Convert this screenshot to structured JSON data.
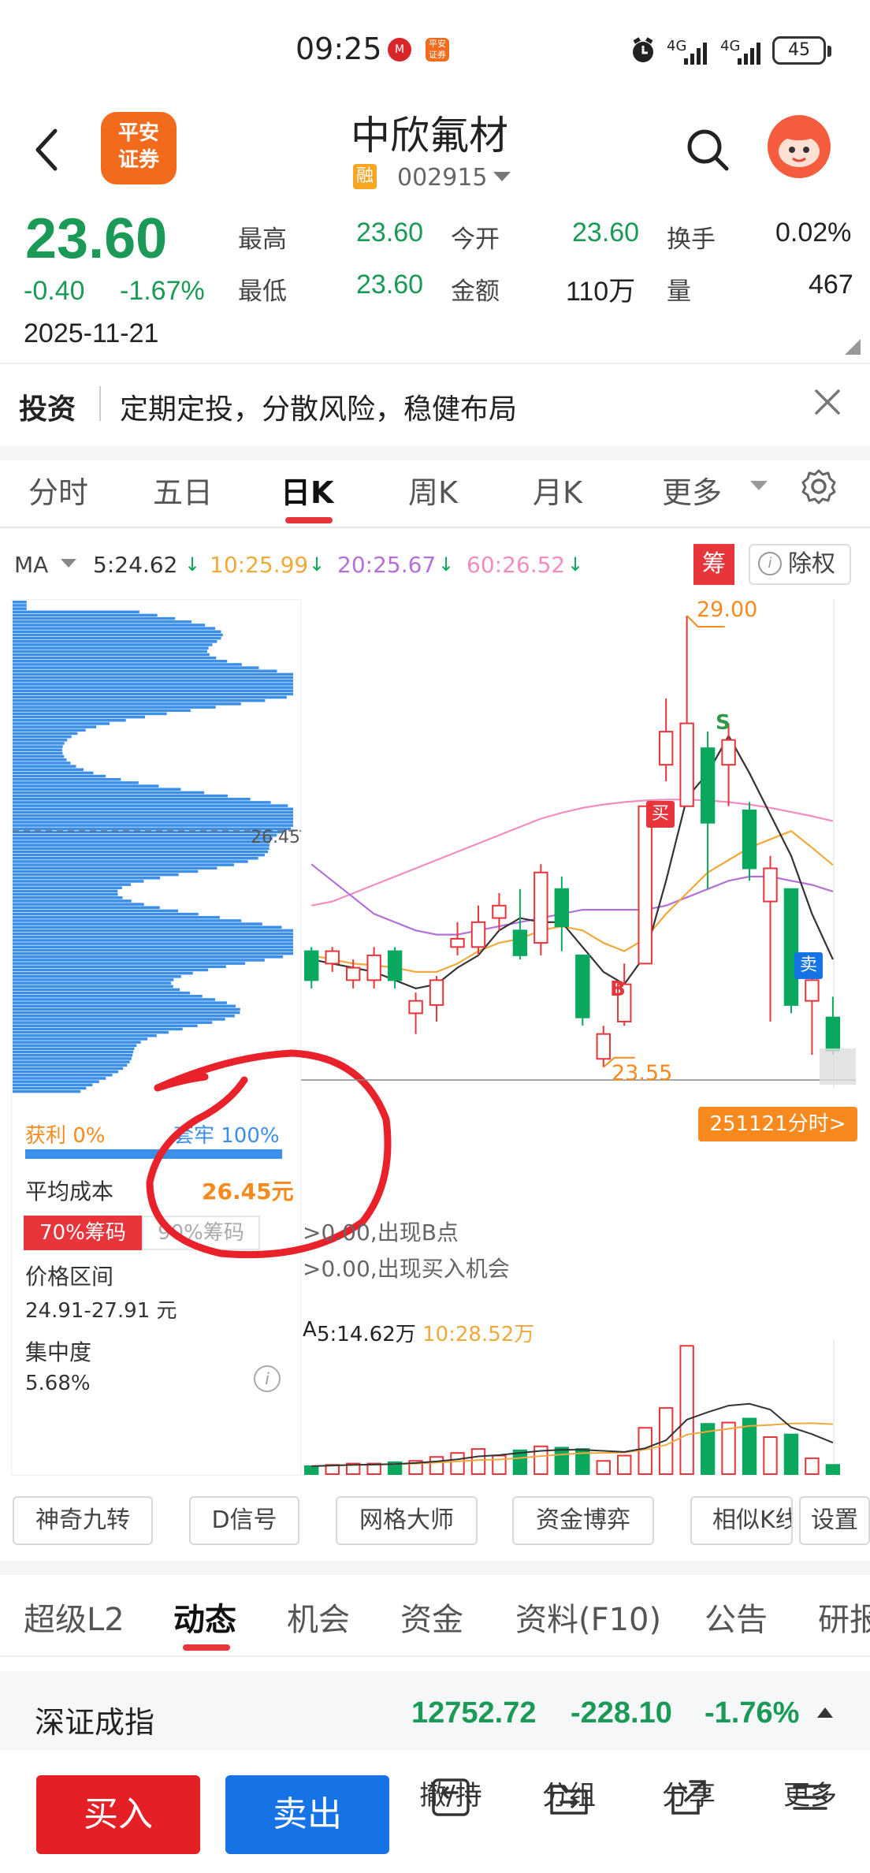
{
  "status_bar": {
    "time": "09:25",
    "battery": "45",
    "network_1": "4G",
    "network_2": "4G",
    "icons": [
      "china-merchants-icon",
      "pingan-app-icon",
      "alarm-icon",
      "signal-icon",
      "signal-icon"
    ]
  },
  "header": {
    "logo_line1": "平安",
    "logo_line2": "证券",
    "stock_name": "中欣氟材",
    "badge": "融",
    "stock_code": "002915"
  },
  "quote": {
    "price": "23.60",
    "change": "-0.40",
    "change_pct": "-1.67%",
    "date": "2025-11-21",
    "high_label": "最高",
    "high": "23.60",
    "low_label": "最低",
    "low": "23.60",
    "open_label": "今开",
    "open": "23.60",
    "amount_label": "金额",
    "amount": "110万",
    "turnover_label": "换手",
    "turnover": "0.02%",
    "volume_label": "量",
    "volume": "467"
  },
  "ad_banner": {
    "tag": "投资",
    "text": "定期定投，分散风险，稳健布局"
  },
  "chart_tabs": [
    "分时",
    "五日",
    "日K",
    "周K",
    "月K",
    "更多"
  ],
  "chart_tabs_active": "日K",
  "ma_row": {
    "label": "MA",
    "ma5": "5:24.62",
    "ma10": "10:25.99",
    "ma20": "20:25.67",
    "ma60": "60:26.52",
    "chip_btn": "筹",
    "exright_btn": "除权"
  },
  "colors": {
    "up": "#e8343b",
    "down": "#0aa85f",
    "ma5": "#333333",
    "ma10": "#f0a93a",
    "ma20": "#b370d8",
    "ma60": "#f28cc0",
    "chip": "#3b8fe8",
    "accent_orange": "#f68a1e",
    "sell_blue": "#1573e6",
    "buy_red": "#e41f26"
  },
  "chip_panel": {
    "price_line": "26.45",
    "profit_label": "获利 0%",
    "trapped_label": "套牢 100%",
    "avg_cost_label": "平均成本",
    "avg_cost": "26.45元",
    "tab_70": "70%筹码",
    "tab_90": "90%筹码",
    "range_label": "价格区间",
    "range_value": "24.91-27.91 元",
    "conc_label": "集中度",
    "conc_value": "5.68%"
  },
  "chart_data": {
    "type": "candlestick",
    "labels": {
      "high": "29.00",
      "low": "23.55",
      "buy_marker": "买",
      "sell_marker": "卖",
      "b_marker": "B",
      "s_marker": "S",
      "time_btn": "251121分时>"
    },
    "price_range": [
      23.3,
      29.2
    ],
    "candles": [
      {
        "o": 24.95,
        "c": 24.6,
        "h": 25.0,
        "l": 24.5
      },
      {
        "o": 24.8,
        "c": 24.95,
        "h": 25.0,
        "l": 24.7
      },
      {
        "o": 24.6,
        "c": 24.75,
        "h": 24.85,
        "l": 24.5
      },
      {
        "o": 24.6,
        "c": 24.9,
        "h": 25.0,
        "l": 24.5
      },
      {
        "o": 24.95,
        "c": 24.6,
        "h": 25.0,
        "l": 24.5
      },
      {
        "o": 24.2,
        "c": 24.35,
        "h": 24.45,
        "l": 23.95
      },
      {
        "o": 24.3,
        "c": 24.6,
        "h": 24.65,
        "l": 24.1
      },
      {
        "o": 25.0,
        "c": 25.1,
        "h": 25.3,
        "l": 24.9
      },
      {
        "o": 25.0,
        "c": 25.3,
        "h": 25.5,
        "l": 24.9
      },
      {
        "o": 25.35,
        "c": 25.5,
        "h": 25.65,
        "l": 25.2
      },
      {
        "o": 25.2,
        "c": 24.9,
        "h": 25.7,
        "l": 24.85
      },
      {
        "o": 25.05,
        "c": 25.9,
        "h": 26.0,
        "l": 24.9
      },
      {
        "o": 25.7,
        "c": 25.25,
        "h": 25.85,
        "l": 24.95
      },
      {
        "o": 24.9,
        "c": 24.15,
        "h": 24.9,
        "l": 24.05
      },
      {
        "o": 23.65,
        "c": 23.95,
        "h": 24.05,
        "l": 23.55
      },
      {
        "o": 24.1,
        "c": 24.55,
        "h": 24.8,
        "l": 24.05
      },
      {
        "o": 24.8,
        "c": 26.7,
        "h": 26.7,
        "l": 24.8
      },
      {
        "o": 27.2,
        "c": 27.6,
        "h": 28.0,
        "l": 27.0
      },
      {
        "o": 26.7,
        "c": 27.7,
        "h": 29.0,
        "l": 26.7
      },
      {
        "o": 27.4,
        "c": 26.5,
        "h": 27.6,
        "l": 25.7
      },
      {
        "o": 27.2,
        "c": 27.5,
        "h": 27.7,
        "l": 26.7
      },
      {
        "o": 26.65,
        "c": 25.95,
        "h": 26.75,
        "l": 25.8
      },
      {
        "o": 25.55,
        "c": 25.95,
        "h": 26.1,
        "l": 24.1
      },
      {
        "o": 25.7,
        "c": 24.3,
        "h": 25.7,
        "l": 24.2
      },
      {
        "o": 24.35,
        "c": 24.6,
        "h": 24.7,
        "l": 23.7
      },
      {
        "o": 24.15,
        "c": 23.75,
        "h": 24.4,
        "l": 23.7
      }
    ],
    "ma5": [
      24.85,
      24.8,
      24.75,
      24.7,
      24.6,
      24.5,
      24.55,
      24.75,
      24.9,
      25.2,
      25.35,
      25.3,
      25.3,
      25.0,
      24.7,
      24.55,
      24.9,
      25.8,
      26.8,
      27.1,
      27.55,
      27.1,
      26.6,
      26.1,
      25.4,
      24.85
    ],
    "ma10": [
      24.9,
      24.85,
      24.8,
      24.78,
      24.75,
      24.7,
      24.7,
      24.8,
      24.95,
      25.05,
      25.1,
      25.2,
      25.25,
      25.2,
      25.05,
      24.95,
      25.1,
      25.4,
      25.65,
      25.9,
      26.05,
      26.2,
      26.3,
      26.4,
      26.2,
      25.99
    ],
    "ma20": [
      26.0,
      25.8,
      25.6,
      25.4,
      25.3,
      25.2,
      25.15,
      25.15,
      25.2,
      25.25,
      25.3,
      25.35,
      25.4,
      25.45,
      25.45,
      25.45,
      25.45,
      25.5,
      25.6,
      25.7,
      25.8,
      25.85,
      25.85,
      25.8,
      25.75,
      25.67
    ],
    "ma60": [
      25.5,
      25.55,
      25.65,
      25.75,
      25.85,
      25.95,
      26.05,
      26.15,
      26.25,
      26.35,
      26.45,
      26.55,
      26.62,
      26.68,
      26.72,
      26.75,
      26.77,
      26.78,
      26.78,
      26.77,
      26.75,
      26.72,
      26.68,
      26.63,
      26.58,
      26.52
    ],
    "volume": {
      "label_prefix": "A",
      "ma5": "5:14.62万",
      "ma10": "10:28.52万",
      "bars": [
        6,
        7,
        8,
        8,
        9,
        10,
        13,
        16,
        19,
        14,
        18,
        21,
        20,
        19,
        10,
        14,
        35,
        50,
        97,
        38,
        39,
        42,
        28,
        30,
        12,
        7
      ]
    },
    "signal_text_1": ">0.00,出现B点",
    "signal_text_2": ">0.00,出现买入机会"
  },
  "tool_buttons": [
    "神奇九转",
    "D信号",
    "网格大师",
    "资金博弈",
    "相似K线",
    "设置"
  ],
  "bottom_tabs": [
    "超级L2",
    "动态",
    "机会",
    "资金",
    "资料(F10)",
    "公告",
    "研报"
  ],
  "bottom_tabs_active": "动态",
  "index_bar": {
    "name": "深证成指",
    "value": "12752.72",
    "change": "-228.10",
    "pct": "-1.76%"
  },
  "bottom_nav": {
    "buy": "买入",
    "sell": "卖出",
    "cancel": "撤/持",
    "group": "分组",
    "share": "分享",
    "more": "更多"
  }
}
